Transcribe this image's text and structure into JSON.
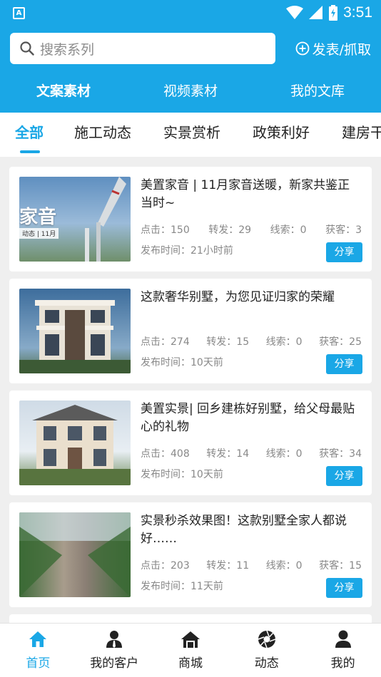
{
  "status_bar": {
    "app_badge": "A",
    "time": "3:51"
  },
  "search": {
    "placeholder": "搜索系列"
  },
  "post_link": {
    "label": "发表/抓取"
  },
  "main_tabs": [
    {
      "label": "文案素材",
      "active": true
    },
    {
      "label": "视频素材",
      "active": false
    },
    {
      "label": "我的文库",
      "active": false
    }
  ],
  "category_tabs": [
    {
      "label": "全部",
      "active": true
    },
    {
      "label": "施工动态"
    },
    {
      "label": "实景赏析"
    },
    {
      "label": "政策利好"
    },
    {
      "label": "建房干"
    }
  ],
  "articles": [
    {
      "title": "美置家音 | 11月家音送暖，新家共鉴正当时~",
      "thumb_text": "家音",
      "thumb_caption": "动态 | 11月",
      "stats": [
        "点击：150",
        "转发：29",
        "线索：0",
        "获客：3"
      ],
      "time": "发布时间：21小时前",
      "share": "分享"
    },
    {
      "title": "这款奢华别墅，为您见证归家的荣耀",
      "stats": [
        "点击：274",
        "转发：15",
        "线索：0",
        "获客：25"
      ],
      "time": "发布时间：10天前",
      "share": "分享"
    },
    {
      "title": "美置实景| 回乡建栋好别墅，给父母最贴心的礼物",
      "stats": [
        "点击：408",
        "转发：14",
        "线索：0",
        "获客：34"
      ],
      "time": "发布时间：10天前",
      "share": "分享"
    },
    {
      "title": "实景秒杀效果图！这款别墅全家人都说好……",
      "stats": [
        "点击：203",
        "转发：11",
        "线索：0",
        "获客：15"
      ],
      "time": "发布时间：11天前",
      "share": "分享"
    }
  ],
  "bottom_nav": [
    {
      "label": "首页",
      "icon": "home-icon",
      "active": true
    },
    {
      "label": "我的客户",
      "icon": "customer-icon"
    },
    {
      "label": "商城",
      "icon": "shop-icon"
    },
    {
      "label": "动态",
      "icon": "aperture-icon"
    },
    {
      "label": "我的",
      "icon": "profile-icon"
    }
  ],
  "colors": {
    "accent": "#1aa7e6",
    "background": "#efefef"
  }
}
